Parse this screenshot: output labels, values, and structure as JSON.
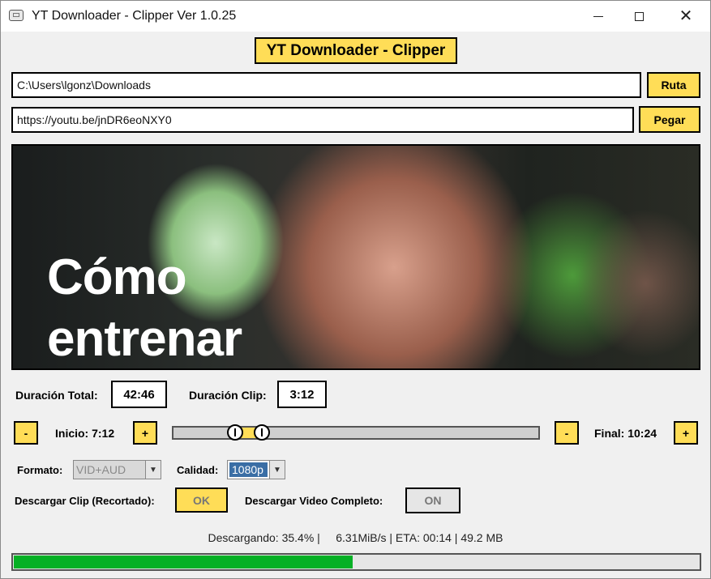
{
  "window": {
    "title": "YT Downloader - Clipper Ver 1.0.25"
  },
  "header": {
    "title": "YT Downloader - Clipper"
  },
  "path": {
    "value": "C:\\Users\\lgonz\\Downloads",
    "button_label": "Ruta"
  },
  "url": {
    "value": "https://youtu.be/jnDR6eoNXY0",
    "button_label": "Pegar"
  },
  "thumbnail": {
    "line1": "Cómo",
    "line2": "entrenar"
  },
  "durations": {
    "total_label": "Duración Total:",
    "total_value": "42:46",
    "clip_label": "Duración Clip:",
    "clip_value": "3:12"
  },
  "trim": {
    "start_minus": "-",
    "start_label": "Inicio: 7:12",
    "start_plus": "+",
    "end_minus": "-",
    "end_label": "Final: 10:24",
    "end_plus": "+",
    "start_fraction": 0.1684,
    "end_fraction": 0.2432
  },
  "format": {
    "label": "Formato:",
    "selected": "VID+AUD"
  },
  "quality": {
    "label": "Calidad:",
    "selected": "1080p"
  },
  "download": {
    "clip_label": "Descargar Clip (Recortado):",
    "clip_button": "OK",
    "full_label": "Descargar Video Completo:",
    "full_button": "ON"
  },
  "status": {
    "text": "Descargando: 35.4% |     6.31MiB/s | ETA: 00:14 | 49.2 MB",
    "progress_fraction": 0.496
  },
  "colors": {
    "accent_yellow": "#ffdd57",
    "progress_green": "#06b025"
  }
}
